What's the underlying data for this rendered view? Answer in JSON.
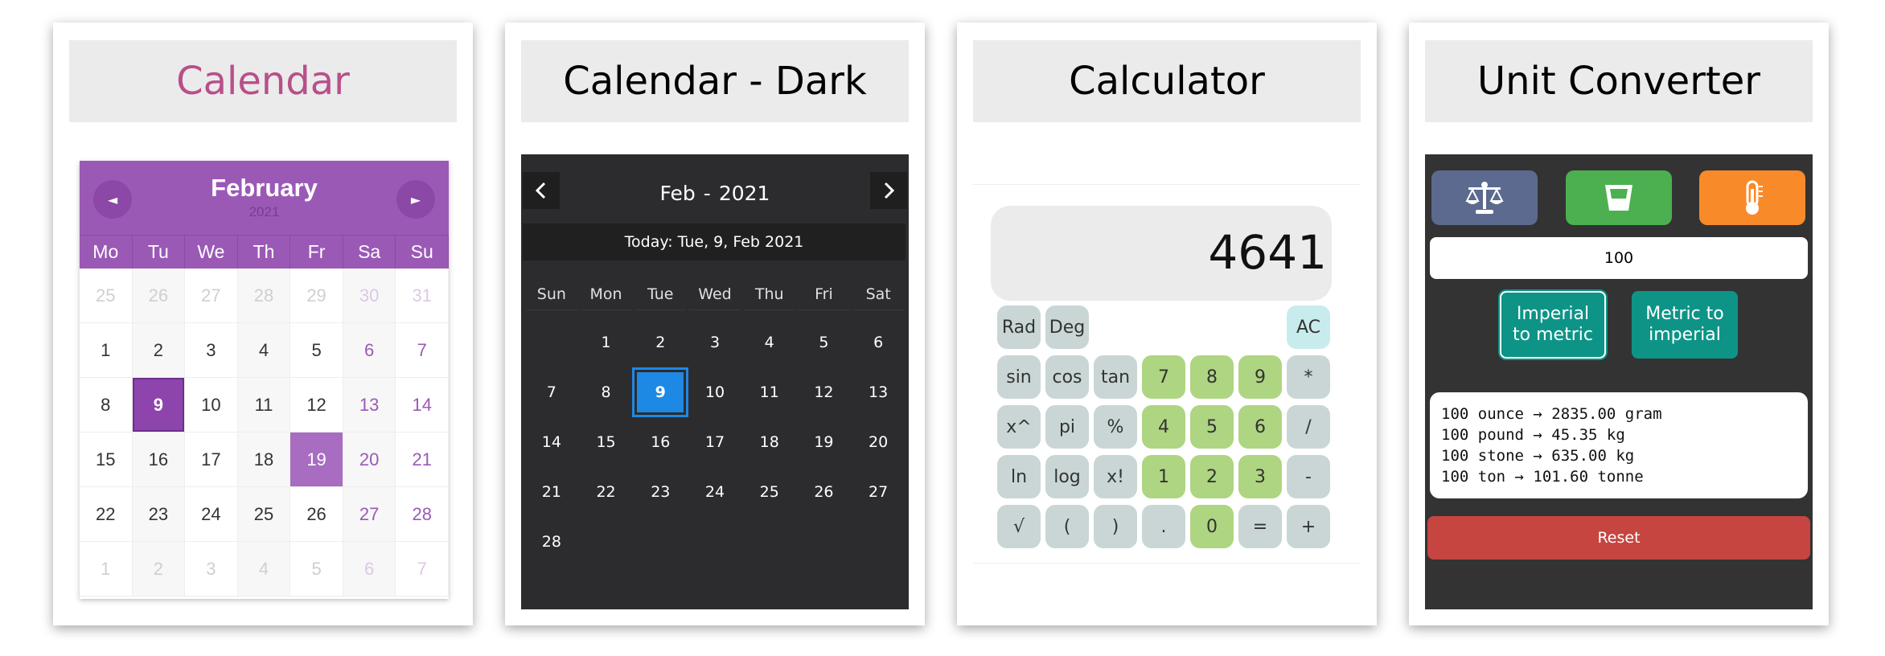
{
  "cards": {
    "calendar": {
      "title": "Calendar",
      "month": "February",
      "year": "2021",
      "nav": {
        "prev": "◄",
        "next": "►"
      },
      "weekdays": [
        "Mo",
        "Tu",
        "We",
        "Th",
        "Fr",
        "Sa",
        "Su"
      ],
      "days": [
        "25",
        "26",
        "27",
        "28",
        "29",
        "30",
        "31",
        "1",
        "2",
        "3",
        "4",
        "5",
        "6",
        "7",
        "8",
        "9",
        "10",
        "11",
        "12",
        "13",
        "14",
        "15",
        "16",
        "17",
        "18",
        "19",
        "20",
        "21",
        "22",
        "23",
        "24",
        "25",
        "26",
        "27",
        "28",
        "1",
        "2",
        "3",
        "4",
        "5",
        "6",
        "7"
      ],
      "today": "9",
      "selected": "19"
    },
    "calendar_dark": {
      "title": "Calendar - Dark",
      "month": "Feb",
      "separator": "-",
      "year": "2021",
      "nav": {
        "prev": "‹",
        "next": "›"
      },
      "today_text": "Today: Tue, 9, Feb 2021",
      "weekdays": [
        "Sun",
        "Mon",
        "Tue",
        "Wed",
        "Thu",
        "Fri",
        "Sat"
      ],
      "days": [
        "",
        "1",
        "2",
        "3",
        "4",
        "5",
        "6",
        "7",
        "8",
        "9",
        "10",
        "11",
        "12",
        "13",
        "14",
        "15",
        "16",
        "17",
        "18",
        "19",
        "20",
        "21",
        "22",
        "23",
        "24",
        "25",
        "26",
        "27",
        "28",
        "",
        "",
        "",
        "",
        "",
        ""
      ],
      "today": "9"
    },
    "calculator": {
      "title": "Calculator",
      "display": "4641",
      "keys": [
        "Rad",
        "Deg",
        "",
        "",
        "",
        "",
        "AC",
        "sin",
        "cos",
        "tan",
        "7",
        "8",
        "9",
        "*",
        "x^",
        "pi",
        "%",
        "4",
        "5",
        "6",
        "/",
        "ln",
        "log",
        "x!",
        "1",
        "2",
        "3",
        "-",
        "√",
        "(",
        ")",
        ".",
        "0",
        "=",
        "+"
      ]
    },
    "unit_converter": {
      "title": "Unit Converter",
      "icons": [
        "scale-icon",
        "glass-icon",
        "thermometer-icon"
      ],
      "input_value": "100",
      "imperial_to_metric": "Imperial to metric",
      "metric_to_imperial": "Metric to imperial",
      "results": [
        "100 ounce → 2835.00 gram",
        "100 pound → 45.35 kg",
        "100 stone → 635.00 kg",
        "100 ton → 101.60 tonne"
      ],
      "reset": "Reset"
    }
  }
}
